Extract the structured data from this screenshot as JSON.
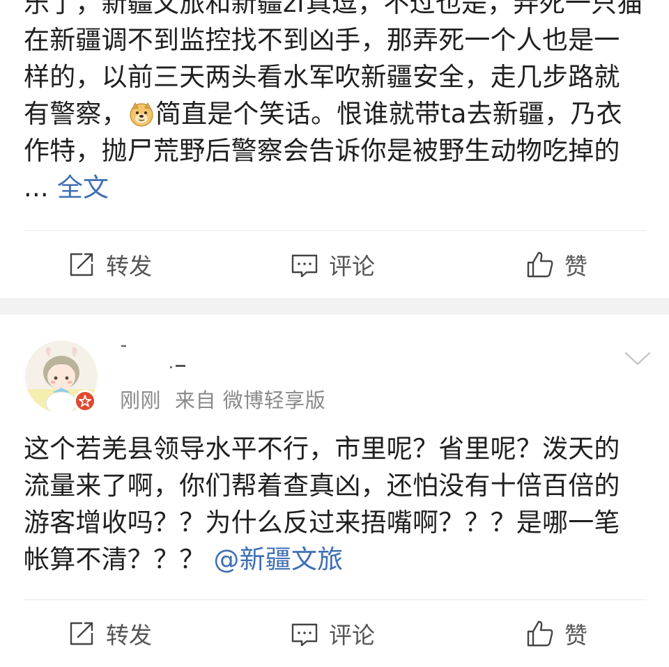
{
  "post1": {
    "text": "乐了，新疆文旅和新疆zf真逗，不过也是，弄死一只猫在新疆调不到监控找不到凶手，那弄死一个人也是一样的，以前三天两头看水军吹新疆安全，走几步路就有警察，",
    "emoji": "doge-emoji",
    "text_after_emoji": "简直是个笑话。恨谁就带ta去新疆，乃衣作特，抛尸荒野后警察会告诉你是被野生动物吃掉的 ... ",
    "full_text_link": "全文"
  },
  "post1_actions": {
    "repost": "转发",
    "comment": "评论",
    "like": "赞"
  },
  "post2": {
    "time": "刚刚",
    "source": "来自 微博轻享版",
    "text": "这个若羌县领导水平不行，市里呢？省里呢？泼天的流量来了啊，你们帮着查真凶，还怕没有十倍百倍的游客增收吗？？为什么反过来捂嘴啊？？？是哪一笔帐算不清？？？",
    "mention": "@新疆文旅"
  },
  "post2_actions": {
    "repost": "转发",
    "comment": "评论",
    "like": "赞"
  },
  "icons": {
    "repost": "repost-icon",
    "comment": "comment-icon",
    "like": "thumbs-up-icon",
    "menu": "chevron-down-icon",
    "badge": "star-badge-icon"
  },
  "colors": {
    "link": "#3f6fb5",
    "text": "#1f1f1f",
    "meta": "#8a8a8a",
    "action": "#555555",
    "separator": "#f2f2f2",
    "badge": "#e0492f"
  }
}
